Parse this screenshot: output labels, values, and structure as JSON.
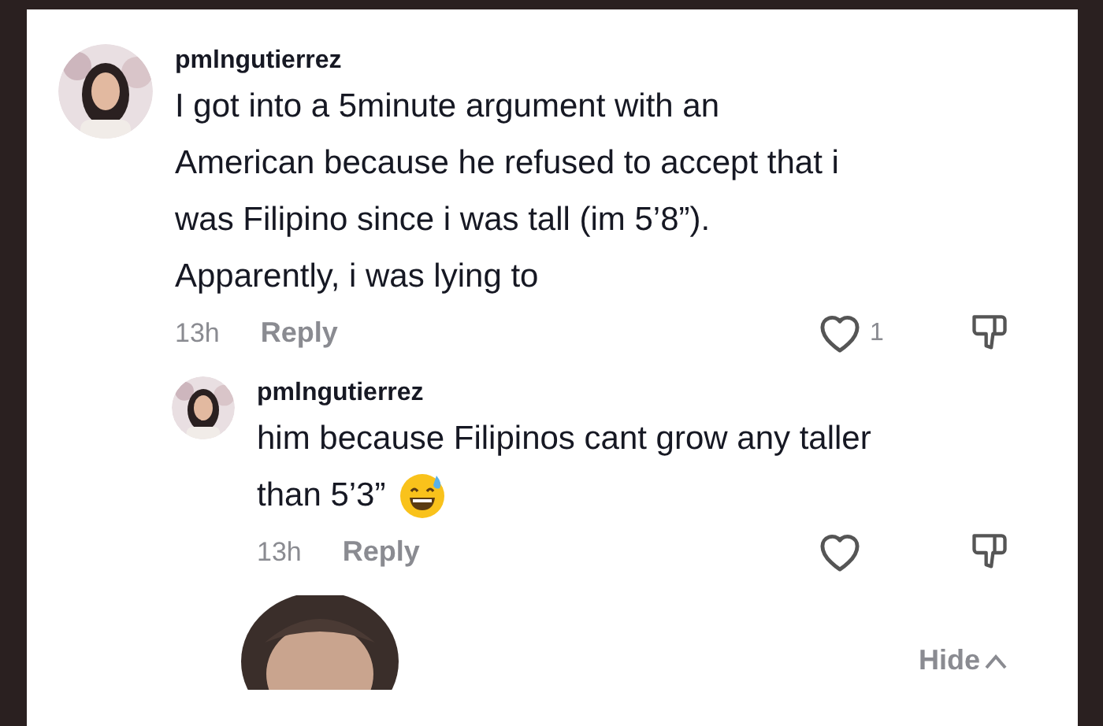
{
  "comments": [
    {
      "username": "pmlngutierrez",
      "lines": [
        "I got into a 5minute argument with an",
        "American because he refused to accept that i",
        "was Filipino since i was tall (im 5’8”).",
        "Apparently, i was lying to"
      ],
      "emoji": false,
      "time": "13h",
      "reply_label": "Reply",
      "liked": false,
      "like_count": "1",
      "is_reply": false
    },
    {
      "username": "pmlngutierrez",
      "lines": [
        "him because Filipinos cant grow any taller",
        "than 5’3”"
      ],
      "emoji": true,
      "time": "13h",
      "reply_label": "Reply",
      "liked": false,
      "is_reply": true
    }
  ],
  "hide_label": "Hide"
}
